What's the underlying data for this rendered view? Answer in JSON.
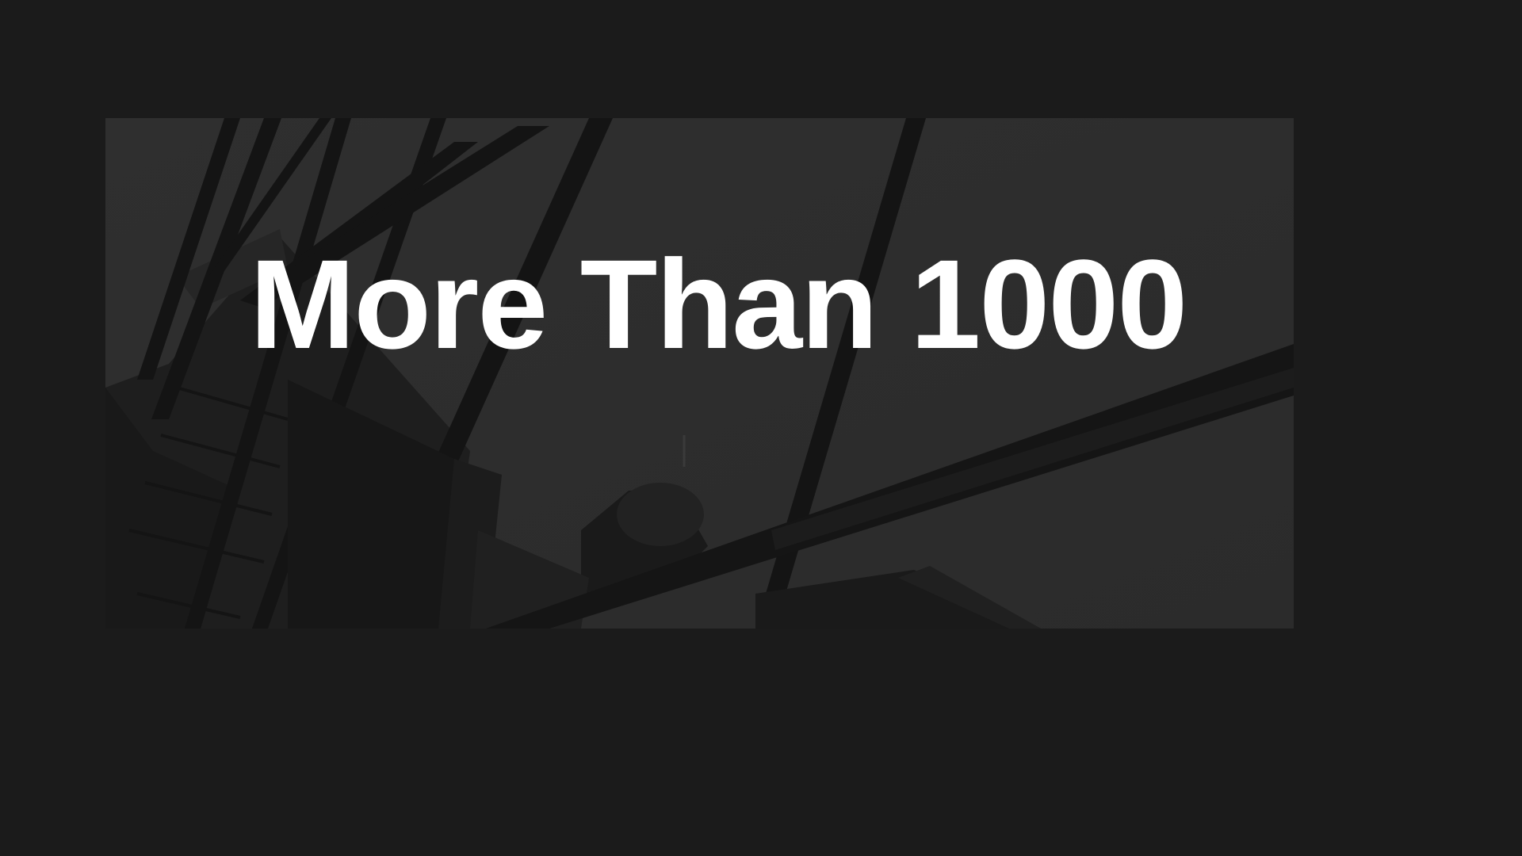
{
  "hero": {
    "headline": "More Than 1000",
    "image": {
      "subject": "building-photo",
      "overlay_color": "#2b2b2b"
    }
  },
  "colors": {
    "page_background": "#1b1b1b",
    "headline_text": "#ffffff"
  }
}
